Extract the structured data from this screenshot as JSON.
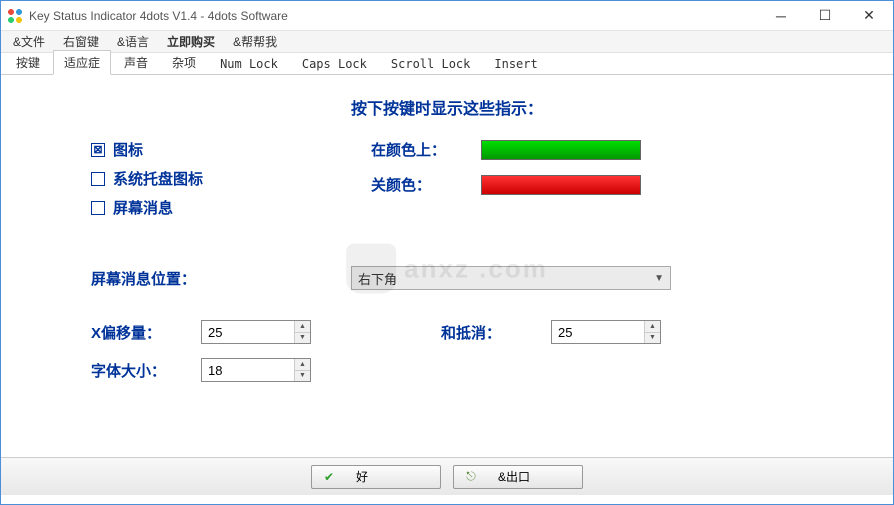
{
  "window": {
    "title": "Key Status Indicator 4dots V1.4 - 4dots Software"
  },
  "menu": {
    "file": "&文件",
    "rightwin": "右窗键",
    "lang": "&语言",
    "buy": "立即购买",
    "help": "&帮帮我"
  },
  "tabs": {
    "t0": "按键",
    "t1": "适应症",
    "t2": "声音",
    "t3": "杂项",
    "t4": "Num Lock",
    "t5": "Caps Lock",
    "t6": "Scroll Lock",
    "t7": "Insert"
  },
  "heading": "按下按键时显示这些指示：",
  "checks": {
    "icon": "图标",
    "tray": "系统托盘图标",
    "osd": "屏幕消息"
  },
  "colors": {
    "on_label": "在颜色上：",
    "off_label": "关颜色：",
    "on_value": "#1BC41B",
    "off_value": "#D90A0A"
  },
  "position": {
    "label": "屏幕消息位置：",
    "value": "右下角"
  },
  "offsets": {
    "x_label": "X偏移量：",
    "x_value": "25",
    "y_label": "和抵消：",
    "y_value": "25",
    "font_label": "字体大小：",
    "font_value": "18"
  },
  "buttons": {
    "ok": "好",
    "exit": "&出口"
  },
  "watermark": {
    "text": "anxz .com"
  }
}
